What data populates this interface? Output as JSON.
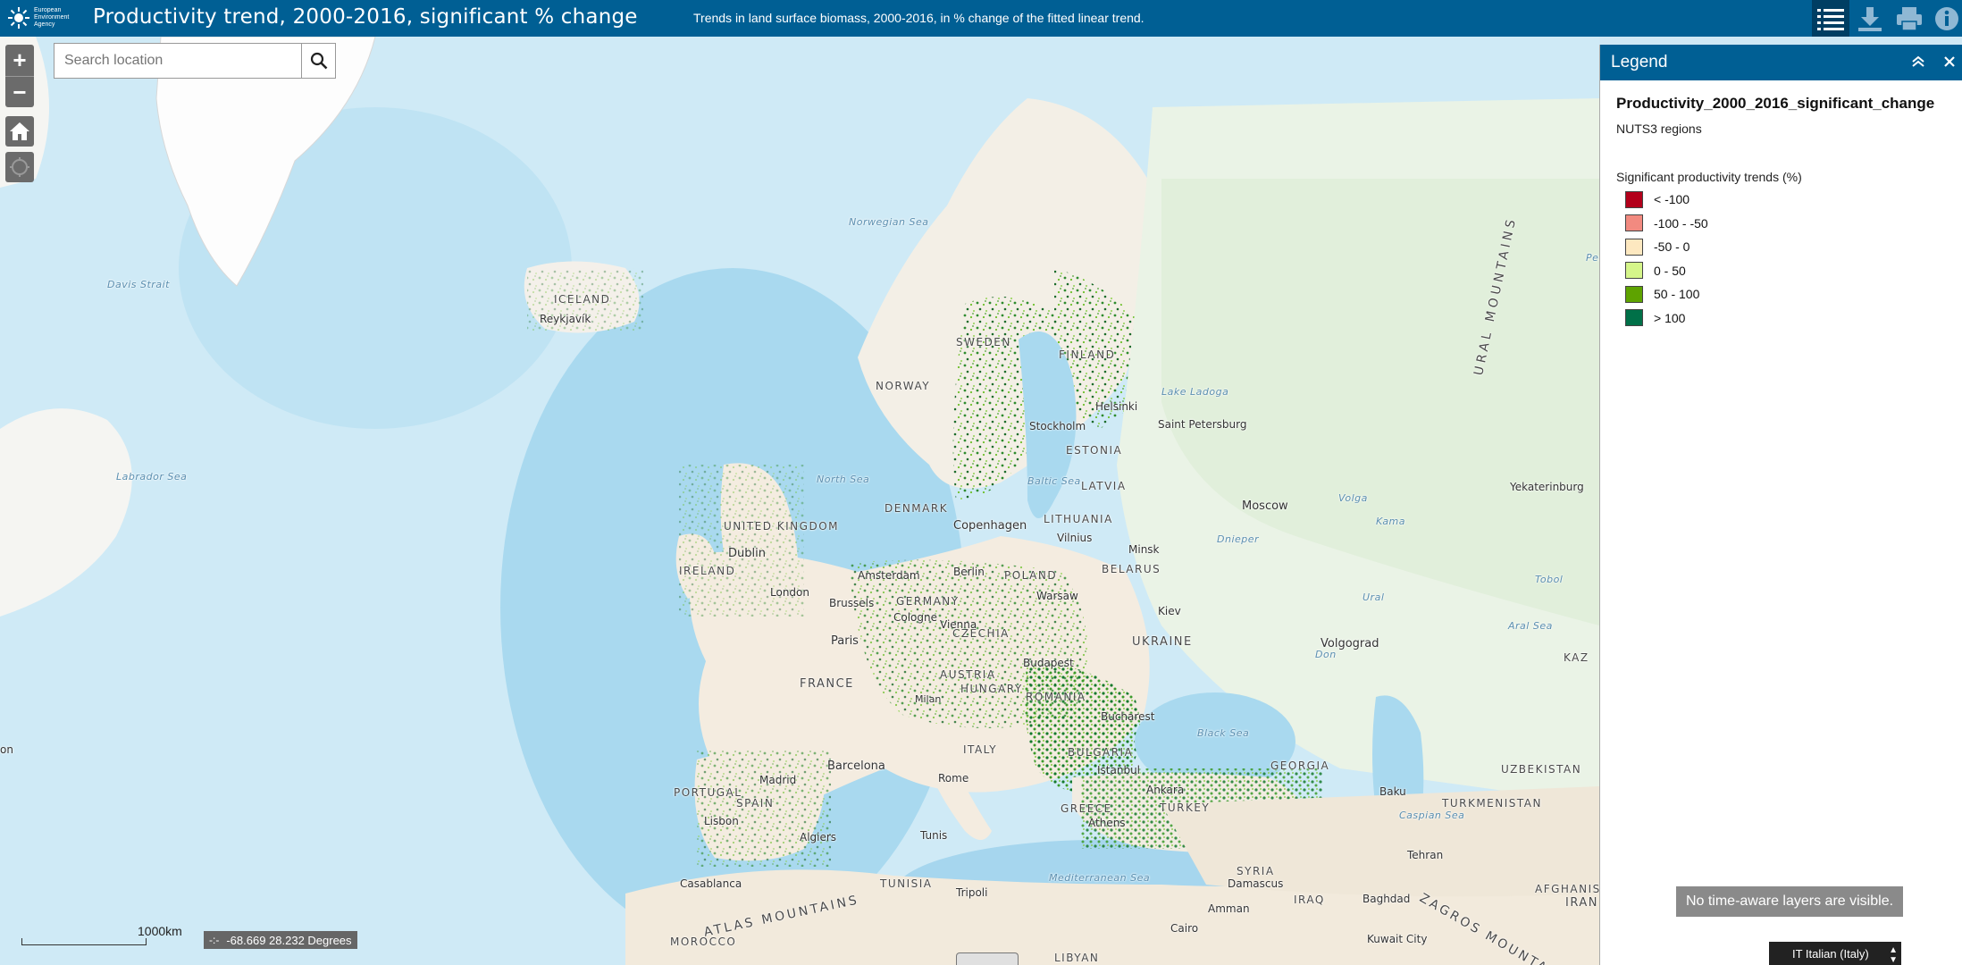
{
  "header": {
    "logo_text": "European Environment Agency",
    "title": "Productivity trend, 2000-2016, significant % change",
    "subtitle": "Trends in land surface biomass, 2000-2016, in % change of the fitted linear trend.",
    "buttons": [
      {
        "name": "legend-list-icon",
        "active": true
      },
      {
        "name": "download-icon",
        "active": false
      },
      {
        "name": "print-icon",
        "active": false
      },
      {
        "name": "info-icon",
        "active": false
      }
    ]
  },
  "map_controls": {
    "zoom_in": "+",
    "zoom_out": "−",
    "search_placeholder": "Search location",
    "scale_label": "1000km",
    "coordinates": "-68.669 28.232 Degrees"
  },
  "map_labels": [
    {
      "text": "ICELAND"
    },
    {
      "text": "Reykjavík"
    },
    {
      "text": "Norwegian Sea"
    },
    {
      "text": "Davis Strait"
    },
    {
      "text": "Labrador Sea"
    },
    {
      "text": "NORWAY"
    },
    {
      "text": "SWEDEN"
    },
    {
      "text": "FINLAND"
    },
    {
      "text": "Helsinki"
    },
    {
      "text": "Stockholm"
    },
    {
      "text": "Lake Ladoga"
    },
    {
      "text": "Saint Petersburg"
    },
    {
      "text": "ESTONIA"
    },
    {
      "text": "LATVIA"
    },
    {
      "text": "Baltic Sea"
    },
    {
      "text": "North Sea"
    },
    {
      "text": "DENMARK"
    },
    {
      "text": "Copenhagen"
    },
    {
      "text": "LITHUANIA"
    },
    {
      "text": "Vilnius"
    },
    {
      "text": "Minsk"
    },
    {
      "text": "BELARUS"
    },
    {
      "text": "Moscow"
    },
    {
      "text": "Volga"
    },
    {
      "text": "UNITED KINGDOM"
    },
    {
      "text": "Dublin"
    },
    {
      "text": "IRELAND"
    },
    {
      "text": "London"
    },
    {
      "text": "Amsterdam"
    },
    {
      "text": "Berlin"
    },
    {
      "text": "POLAND"
    },
    {
      "text": "Warsaw"
    },
    {
      "text": "GERMANY"
    },
    {
      "text": "Brussels"
    },
    {
      "text": "Cologne"
    },
    {
      "text": "Paris"
    },
    {
      "text": "FRANCE"
    },
    {
      "text": "CZECHIA"
    },
    {
      "text": "AUSTRIA"
    },
    {
      "text": "HUNGARY"
    },
    {
      "text": "Vienna"
    },
    {
      "text": "Budapest"
    },
    {
      "text": "Kiev"
    },
    {
      "text": "UKRAINE"
    },
    {
      "text": "Volgograd"
    },
    {
      "text": "ROMANIA"
    },
    {
      "text": "Bucharest"
    },
    {
      "text": "Milan"
    },
    {
      "text": "BULGARIA"
    },
    {
      "text": "Black Sea"
    },
    {
      "text": "Istanbul"
    },
    {
      "text": "Ankara"
    },
    {
      "text": "TURKEY"
    },
    {
      "text": "GREECE"
    },
    {
      "text": "Athens"
    },
    {
      "text": "ITALY"
    },
    {
      "text": "Rome"
    },
    {
      "text": "Barcelona"
    },
    {
      "text": "Madrid"
    },
    {
      "text": "SPAIN"
    },
    {
      "text": "PORTUGAL"
    },
    {
      "text": "Lisbon"
    },
    {
      "text": "Algiers"
    },
    {
      "text": "Tunis"
    },
    {
      "text": "TUNISIA"
    },
    {
      "text": "Tripoli"
    },
    {
      "text": "ATLAS MOUNTAINS"
    },
    {
      "text": "Casablanca"
    },
    {
      "text": "MOROCCO"
    },
    {
      "text": "Mediterranean Sea"
    },
    {
      "text": "LIBYAN"
    },
    {
      "text": "Cairo"
    },
    {
      "text": "SYRIA"
    },
    {
      "text": "Damascus"
    },
    {
      "text": "IRAQ"
    },
    {
      "text": "Baghdad"
    },
    {
      "text": "Amman"
    },
    {
      "text": "Kuwait City"
    },
    {
      "text": "IRAN"
    },
    {
      "text": "Tehran"
    },
    {
      "text": "Baku"
    },
    {
      "text": "Caspian Sea"
    },
    {
      "text": "GEORGIA"
    },
    {
      "text": "TURKMENISTAN"
    },
    {
      "text": "UZBEKISTAN"
    },
    {
      "text": "AFGHANISTAN"
    },
    {
      "text": "ZAGROS MOUNTAINS"
    },
    {
      "text": "URAL MOUNTAINS"
    },
    {
      "text": "Yekaterinburg"
    },
    {
      "text": "Aral Sea"
    },
    {
      "text": "KAZ"
    },
    {
      "text": "Ural"
    },
    {
      "text": "Pechora"
    },
    {
      "text": "Kama"
    },
    {
      "text": "Don"
    },
    {
      "text": "Tobol"
    },
    {
      "text": "Dnieper"
    },
    {
      "text": "on"
    }
  ],
  "legend": {
    "title": "Legend",
    "layer_name": "Productivity_2000_2016_significant_change",
    "layer_sub": "NUTS3 regions",
    "field_title": "Significant productivity trends (%)",
    "items": [
      {
        "label": "< -100",
        "color": "#b3001b"
      },
      {
        "label": "-100 - -50",
        "color": "#f28a80"
      },
      {
        "label": "-50 - 0",
        "color": "#fde8c0"
      },
      {
        "label": "0 - 50",
        "color": "#d5f58a"
      },
      {
        "label": "50 - 100",
        "color": "#5ea300"
      },
      {
        "label": "> 100",
        "color": "#007048"
      }
    ]
  },
  "status": {
    "time_aware": "No time-aware layers are visible.",
    "language": "IT  Italian (Italy)"
  }
}
